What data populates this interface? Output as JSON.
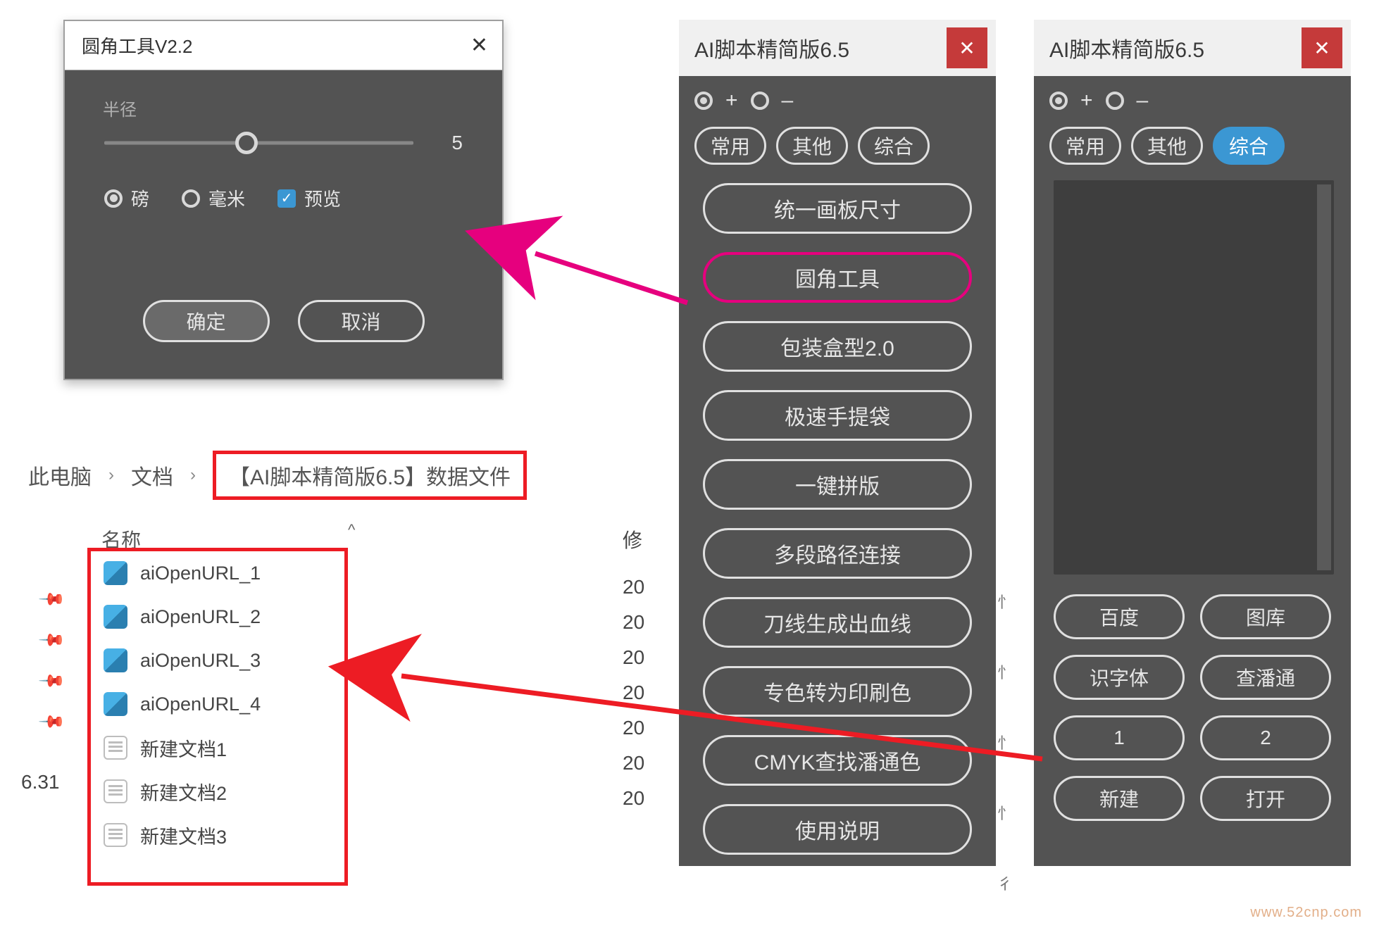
{
  "dialog": {
    "title": "圆角工具V2.2",
    "close": "✕",
    "radius_label": "半径",
    "radius_value": "5",
    "unit_bang": "磅",
    "unit_mm": "毫米",
    "preview": "预览",
    "ok": "确定",
    "cancel": "取消"
  },
  "breadcrumb": {
    "p0": "此电脑",
    "p1": "文档",
    "p2": "【AI脚本精简版6.5】数据文件"
  },
  "filelist": {
    "col_name": "名称",
    "col_mod": "修",
    "left_label": "6.31",
    "items": [
      {
        "icon": "url",
        "name": "aiOpenURL_1",
        "mod": "20"
      },
      {
        "icon": "url",
        "name": "aiOpenURL_2",
        "mod": "20"
      },
      {
        "icon": "url",
        "name": "aiOpenURL_3",
        "mod": "20"
      },
      {
        "icon": "url",
        "name": "aiOpenURL_4",
        "mod": "20"
      },
      {
        "icon": "doc",
        "name": "新建文档1",
        "mod": "20"
      },
      {
        "icon": "doc",
        "name": "新建文档2",
        "mod": "20"
      },
      {
        "icon": "doc",
        "name": "新建文档3",
        "mod": "20"
      }
    ]
  },
  "panelA": {
    "title": "AI脚本精简版6.5",
    "close": "✕",
    "plus": "+",
    "minus": "–",
    "tabs": [
      "常用",
      "其他",
      "综合"
    ],
    "actions": [
      "统一画板尺寸",
      "圆角工具",
      "包装盒型2.0",
      "极速手提袋",
      "一键拼版",
      "多段路径连接",
      "刀线生成出血线",
      "专色转为印刷色",
      "CMYK查找潘通色",
      "使用说明"
    ]
  },
  "panelB": {
    "title": "AI脚本精简版6.5",
    "close": "✕",
    "plus": "+",
    "minus": "–",
    "tabs": [
      "常用",
      "其他",
      "综合"
    ],
    "grid": [
      "百度",
      "图库",
      "识字体",
      "查潘通",
      "1",
      "2",
      "新建",
      "打开"
    ]
  },
  "midcol": [
    "忄",
    "忄",
    "忄",
    "忄",
    "彳"
  ],
  "watermark": "www.52cnp.com"
}
